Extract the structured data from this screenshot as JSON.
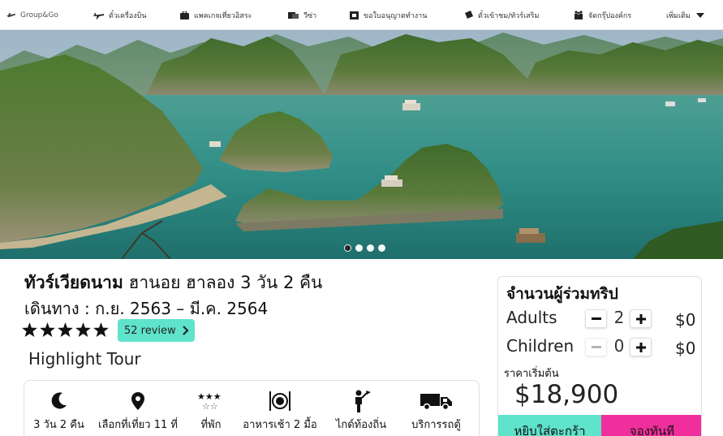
{
  "nav": {
    "brand": "Group&Go",
    "items": [
      {
        "label": "ตั๋วเครื่องบิน",
        "icon": "plane-icon"
      },
      {
        "label": "แพคเกจเที่ยวอิสระ",
        "icon": "suitcase-icon"
      },
      {
        "label": "วีซ่า",
        "icon": "visa-icon"
      },
      {
        "label": "ขอใบอนุญาตทำงาน",
        "icon": "work-permit-icon"
      },
      {
        "label": "ตั๋วเข้าชม/ทัวร์เสริม",
        "icon": "ticket-icon"
      },
      {
        "label": "จัดกรุ๊ปองค์กร",
        "icon": "group-icon"
      }
    ],
    "more": "เพิ่มเติม"
  },
  "hero": {
    "slides_total": 4,
    "active_slide": 1
  },
  "tour": {
    "title_bold": "ทัวร์เวียดนาม",
    "title_rest": " ฮานอย ฮาลอง 3 วัน 2 คืน",
    "dates": "เดินทาง : ก.ย. 2563 – มี.ค. 2564",
    "rating": 5,
    "review_label": "52 review",
    "highlight": "Highlight Tour"
  },
  "features": [
    {
      "label": "3 วัน 2 คืน",
      "icon": "moon-icon"
    },
    {
      "label": "เลือกที่เที่ยว 11 ที่",
      "icon": "location-pin-icon"
    },
    {
      "label": "ที่พัก",
      "icon": "hotel-stars-icon"
    },
    {
      "label": "อาหารเช้า 2 มื้อ",
      "icon": "meal-icon"
    },
    {
      "label": "ไกด์ท้องถิ่น",
      "icon": "guide-icon"
    },
    {
      "label": "บริการรถตู้",
      "icon": "van-icon"
    }
  ],
  "booking": {
    "title": "จำนวนผู้ร่วมทริป",
    "adults_label": "Adults",
    "adults_qty": "2",
    "adults_price": "$0",
    "children_label": "Children",
    "children_qty": "0",
    "children_price": "$0",
    "start_price_label": "ราคาเริ่มต้น",
    "start_price": "$18,900",
    "add_to_cart": "หยิบใส่ตะกร้า",
    "book_now": "จองทันที"
  },
  "colors": {
    "accent_teal": "#5fe3cb",
    "accent_pink": "#f02f9c"
  }
}
